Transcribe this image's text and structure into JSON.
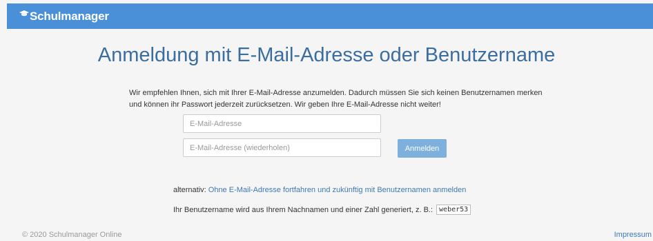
{
  "header": {
    "brand": "Schulmanager",
    "logo_icon": "graduation-cap-icon"
  },
  "page": {
    "title": "Anmeldung mit E-Mail-Adresse oder Benutzername",
    "intro": "Wir empfehlen Ihnen, sich mit Ihrer E-Mail-Adresse anzumelden. Dadurch müssen Sie sich keinen Benutzernamen merken und können ihr Passwort jederzeit zurücksetzen. Wir geben Ihre E-Mail-Adresse nicht weiter!"
  },
  "form": {
    "email_placeholder": "E-Mail-Adresse",
    "email_repeat_placeholder": "E-Mail-Adresse (wiederholen)",
    "submit_label": "Anmelden"
  },
  "alternative": {
    "prefix": "alternativ:",
    "link_text": "Ohne E-Mail-Adresse fortfahren und zukünftig mit Benutzernamen anmelden"
  },
  "username_hint": {
    "text": "Ihr Benutzername wird aus Ihrem Nachnamen und einer Zahl generiert, z. B.:",
    "example": "weber53"
  },
  "footer": {
    "copyright": "© 2020 Schulmanager Online",
    "impressum": "Impressum"
  }
}
